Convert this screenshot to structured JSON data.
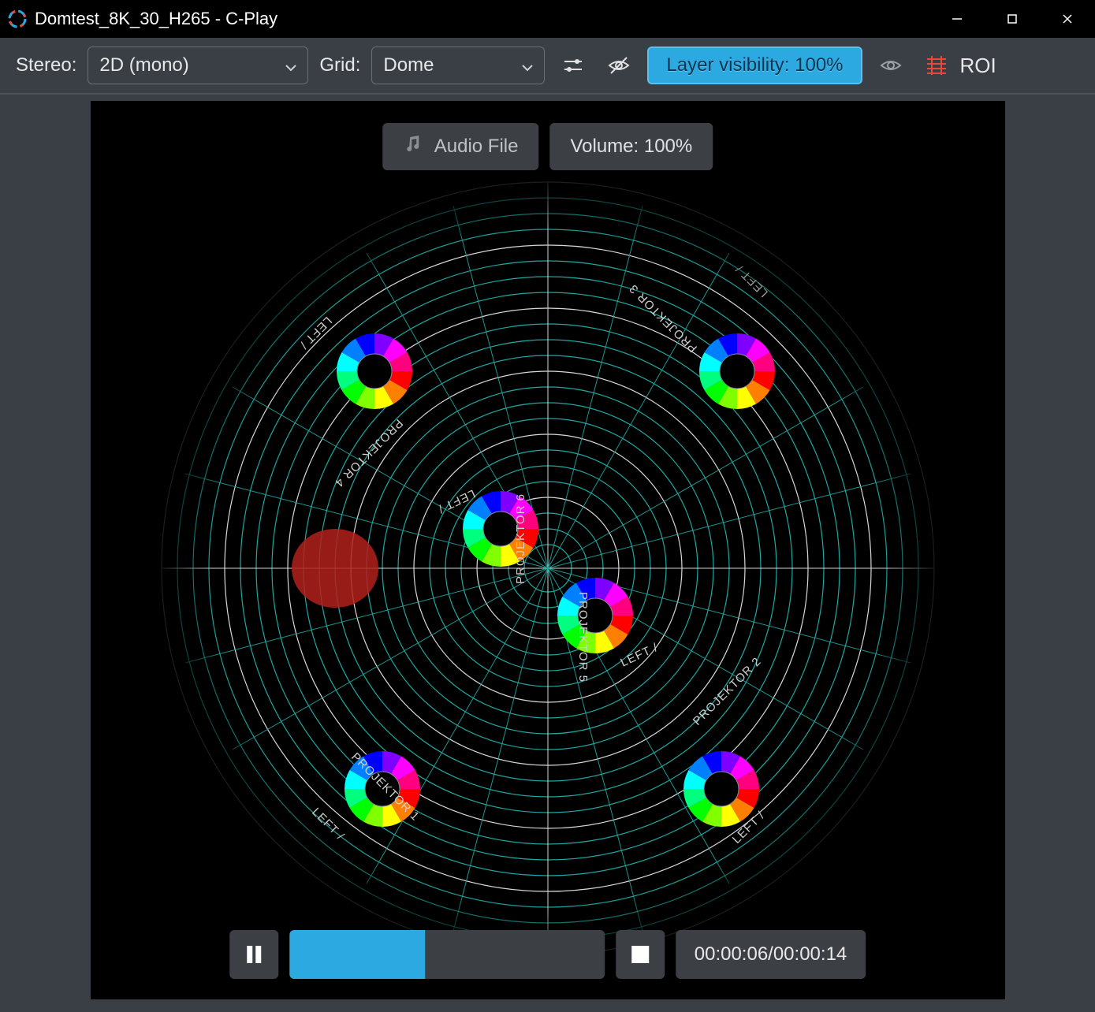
{
  "window": {
    "title": "Domtest_8K_30_H265 - C-Play"
  },
  "toolbar": {
    "stereo_label": "Stereo:",
    "stereo_value": "2D (mono)",
    "grid_label": "Grid:",
    "grid_value": "Dome",
    "layer_visibility": "Layer visibility: 100%",
    "roi": "ROI"
  },
  "audio": {
    "audio_file_label": "Audio File",
    "volume_label": "Volume: 100%"
  },
  "dome": {
    "projectors": [
      {
        "name": "PROJEKTOR 1",
        "side": "LEFT /",
        "num": "1"
      },
      {
        "name": "PROJEKTOR 2",
        "side": "LEFT /",
        "num": "2"
      },
      {
        "name": "PROJEKTOR 3",
        "side": "LEFT /",
        "num": "3"
      },
      {
        "name": "PROJEKTOR 4",
        "side": "LEFT /",
        "num": "4"
      },
      {
        "name": "PROJEKTOR 5",
        "side": "LEFT /",
        "num": "5"
      },
      {
        "name": "PROJEKTOR 6",
        "side": "LEFT /",
        "num": "6"
      }
    ]
  },
  "playback": {
    "current": "00:00:06",
    "total": "00:00:14",
    "separator": " / ",
    "progress_pct": 43
  },
  "colors": {
    "accent": "#2ca9e1",
    "panel": "#3a3e45",
    "pill": "#3c3f44"
  }
}
